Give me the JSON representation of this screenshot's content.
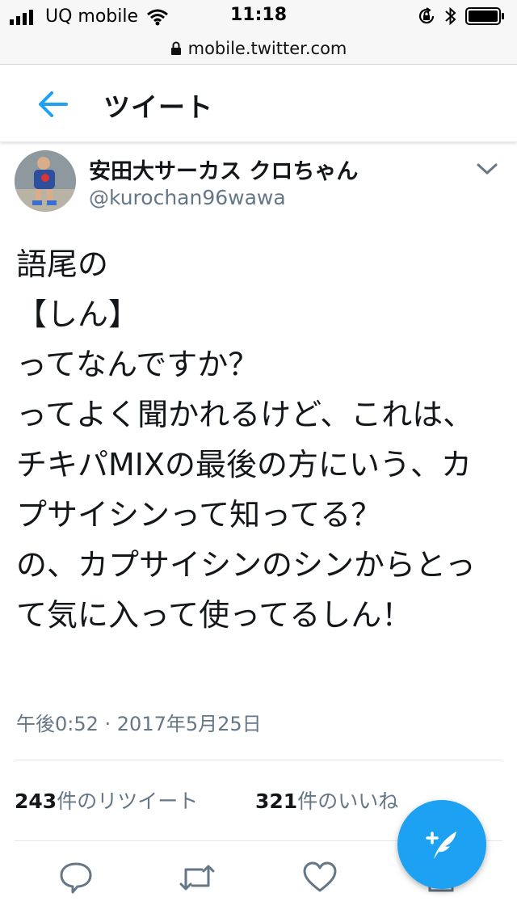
{
  "status_bar": {
    "carrier": "UQ mobile",
    "time": "11:18"
  },
  "browser": {
    "url": "mobile.twitter.com"
  },
  "header": {
    "title": "ツイート"
  },
  "tweet": {
    "display_name": "安田大サーカス クロちゃん",
    "screen_name": "@kurochan96wawa",
    "text": "語尾の\n【しん】\nってなんですか？\nってよく聞かれるけど、これは、チキパMIXの最後の方にいう、カプサイシンって知ってる？\nの、カプサイシンのシンからとって気に入って使ってるしん！",
    "timestamp": "午後0:52 · 2017年5月25日",
    "retweets": {
      "count": "243",
      "label": "件のリツイート"
    },
    "likes": {
      "count": "321",
      "label": "件のいいね"
    }
  },
  "colors": {
    "accent": "#1da1f2",
    "secondary_text": "#657786",
    "primary_text": "#14171a",
    "border": "#e1e8ed"
  },
  "icons": {
    "back": "arrow-left-icon",
    "caret": "chevron-down-icon",
    "reply": "reply-icon",
    "retweet": "retweet-icon",
    "like": "heart-icon",
    "share": "share-icon",
    "compose": "compose-tweet-icon"
  }
}
